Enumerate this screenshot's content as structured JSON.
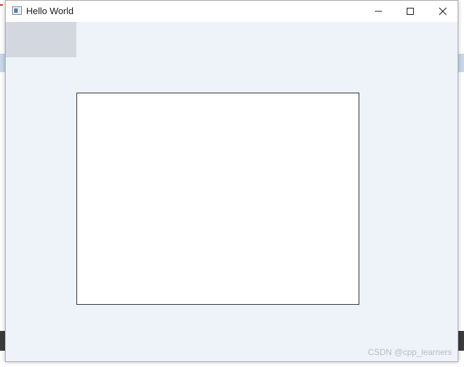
{
  "window": {
    "title": "Hello World",
    "controls": {
      "minimize_icon": "minimize-icon",
      "maximize_icon": "maximize-icon",
      "close_icon": "close-icon"
    }
  },
  "watermark": "CSDN @cpp_learners",
  "colors": {
    "client_background": "#eef2f9",
    "titlebar": "#ffffff",
    "menu_placeholder": "#d3d8e0",
    "canvas": "#ffffff",
    "canvas_border": "#333333"
  }
}
